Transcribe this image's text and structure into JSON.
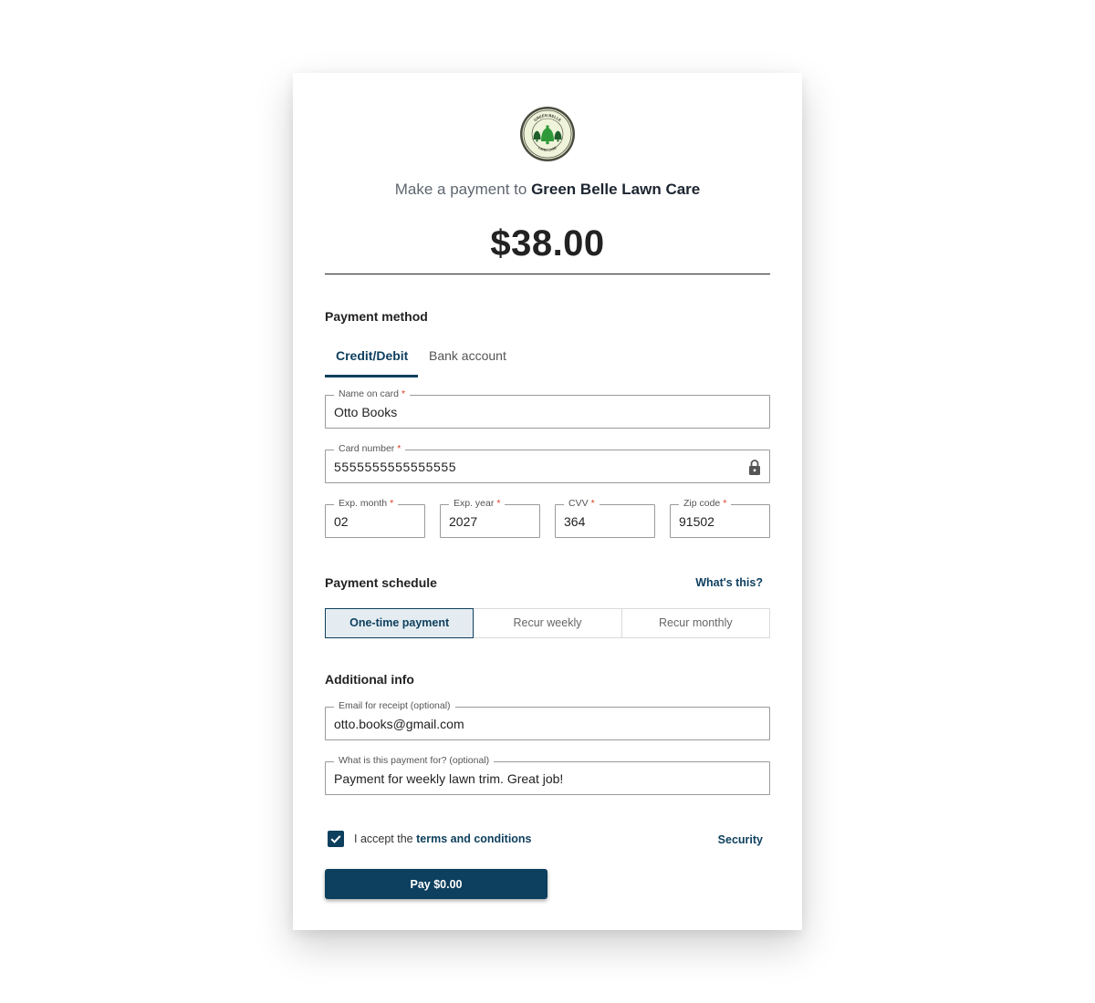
{
  "merchant": {
    "logo_icon": "green-belle-bells-logo-icon",
    "logo_text_top": "GREEN BELLE",
    "logo_text_bottom": "LAWN CARE",
    "prefix": "Make a payment to",
    "name": "Green Belle Lawn Care"
  },
  "amount": "$38.00",
  "payment_method": {
    "title": "Payment method",
    "tabs": [
      {
        "label": "Credit/Debit",
        "active": true
      },
      {
        "label": "Bank account",
        "active": false
      }
    ]
  },
  "card": {
    "name": {
      "label": "Name on card",
      "required": "*",
      "value": "Otto Books"
    },
    "number": {
      "label": "Card number",
      "required": "*",
      "value": "5555555555555555",
      "icon": "lock-icon"
    },
    "exp_month": {
      "label": "Exp. month",
      "required": "*",
      "value": "02"
    },
    "exp_year": {
      "label": "Exp. year",
      "required": "*",
      "value": "2027"
    },
    "cvv": {
      "label": "CVV",
      "required": "*",
      "value": "364"
    },
    "zip": {
      "label": "Zip code",
      "required": "*",
      "value": "91502"
    }
  },
  "schedule": {
    "title": "Payment schedule",
    "help_link": "What's this?",
    "options": [
      {
        "label": "One-time payment",
        "selected": true
      },
      {
        "label": "Recur weekly",
        "selected": false
      },
      {
        "label": "Recur monthly",
        "selected": false
      }
    ]
  },
  "additional": {
    "title": "Additional info",
    "email": {
      "label": "Email for receipt (optional)",
      "value": "otto.books@gmail.com"
    },
    "memo": {
      "label": "What is this payment for? (optional)",
      "value": "Payment for weekly lawn trim. Great job!"
    }
  },
  "terms": {
    "checked": true,
    "prefix": "I accept the",
    "link": "terms and conditions",
    "check_icon": "checkmark-icon"
  },
  "security_link": "Security",
  "pay_button": "Pay $0.00",
  "colors": {
    "accent": "#0d3f5e",
    "required": "#d93b1f",
    "selected_bg": "#e5ecf1"
  }
}
